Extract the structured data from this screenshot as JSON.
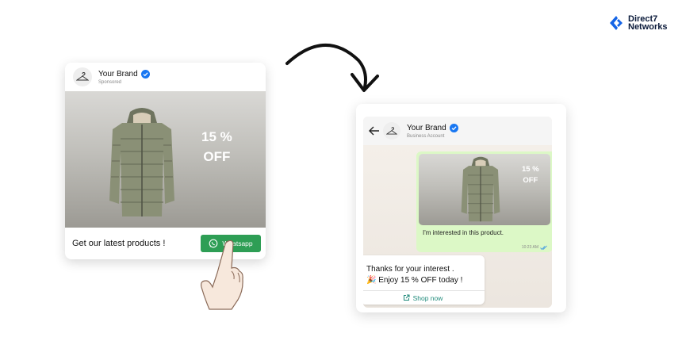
{
  "logo": {
    "line1": "Direct7",
    "line2": "Networks",
    "icon": "direct7-logo-icon",
    "color": "#1464e6"
  },
  "ad": {
    "brand": "Your Brand",
    "sponsored": "Sponsored",
    "offer_line1": "15 %",
    "offer_line2": "OFF",
    "tagline": "Get our latest products !",
    "cta_label": "Whatsapp",
    "cta_color": "#2e9e55",
    "avatar_icon": "hanger-icon",
    "verified_icon": "verified-badge-icon"
  },
  "chat": {
    "brand": "Your Brand",
    "subtitle": "Business Account",
    "product_offer_line1": "15 %",
    "product_offer_line2": "OFF",
    "outgoing_message": "I'm interested in this product.",
    "timestamp": "10:23 AM",
    "incoming_line1": "Thanks for your interest .",
    "incoming_line2": "🎉 Enjoy 15 % OFF today !",
    "shop_label": "Shop now",
    "outgoing_bubble_color": "#dcf8c6",
    "link_color": "#1f8a7a"
  }
}
